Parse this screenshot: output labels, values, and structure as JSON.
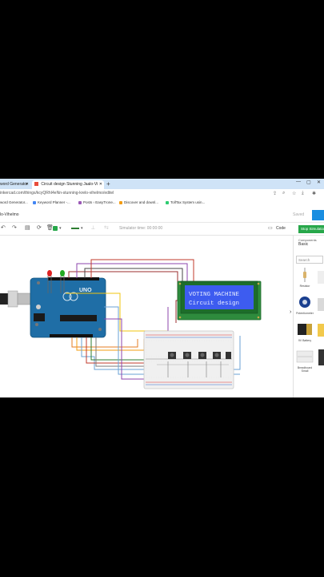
{
  "browser": {
    "tab_prev_label": "word Generator",
    "tab_active_label": "Circuit design Stunning Jaalo-Vi",
    "url": "inkercad.com/things/kcyQRhI4eNn-stunning-krelo-vihelmo/editel",
    "bookmarks": [
      "word Generator...",
      "Keyword Planner -...",
      "Posts ‹ EasyTrone...",
      "Discover and downl...",
      "TollTax System usin..."
    ],
    "bookmark_colors": [
      "#888888",
      "#4285f4",
      "#9b59b6",
      "#f39c12",
      "#2ecc71"
    ]
  },
  "app": {
    "project_name": "lo-Vihelmo",
    "save_label": "Saved",
    "simulator_time": "Simulator time: 00:00:00",
    "code_label": "Code",
    "stop_label": "Stop Simulation",
    "accent_green": "#27a74a",
    "accent_blue": "#1a8ee1"
  },
  "lcd": {
    "line1": "VOTING MACHINE",
    "line2": "Circuit design",
    "backlight": "#3d5cf0",
    "text_color": "#e6ecff"
  },
  "panel": {
    "heading": "Components",
    "category": "Basic",
    "search_placeholder": "Search",
    "components": [
      "Resistor",
      "Potentiometer",
      "9V Battery",
      "Breadboard Small"
    ]
  }
}
